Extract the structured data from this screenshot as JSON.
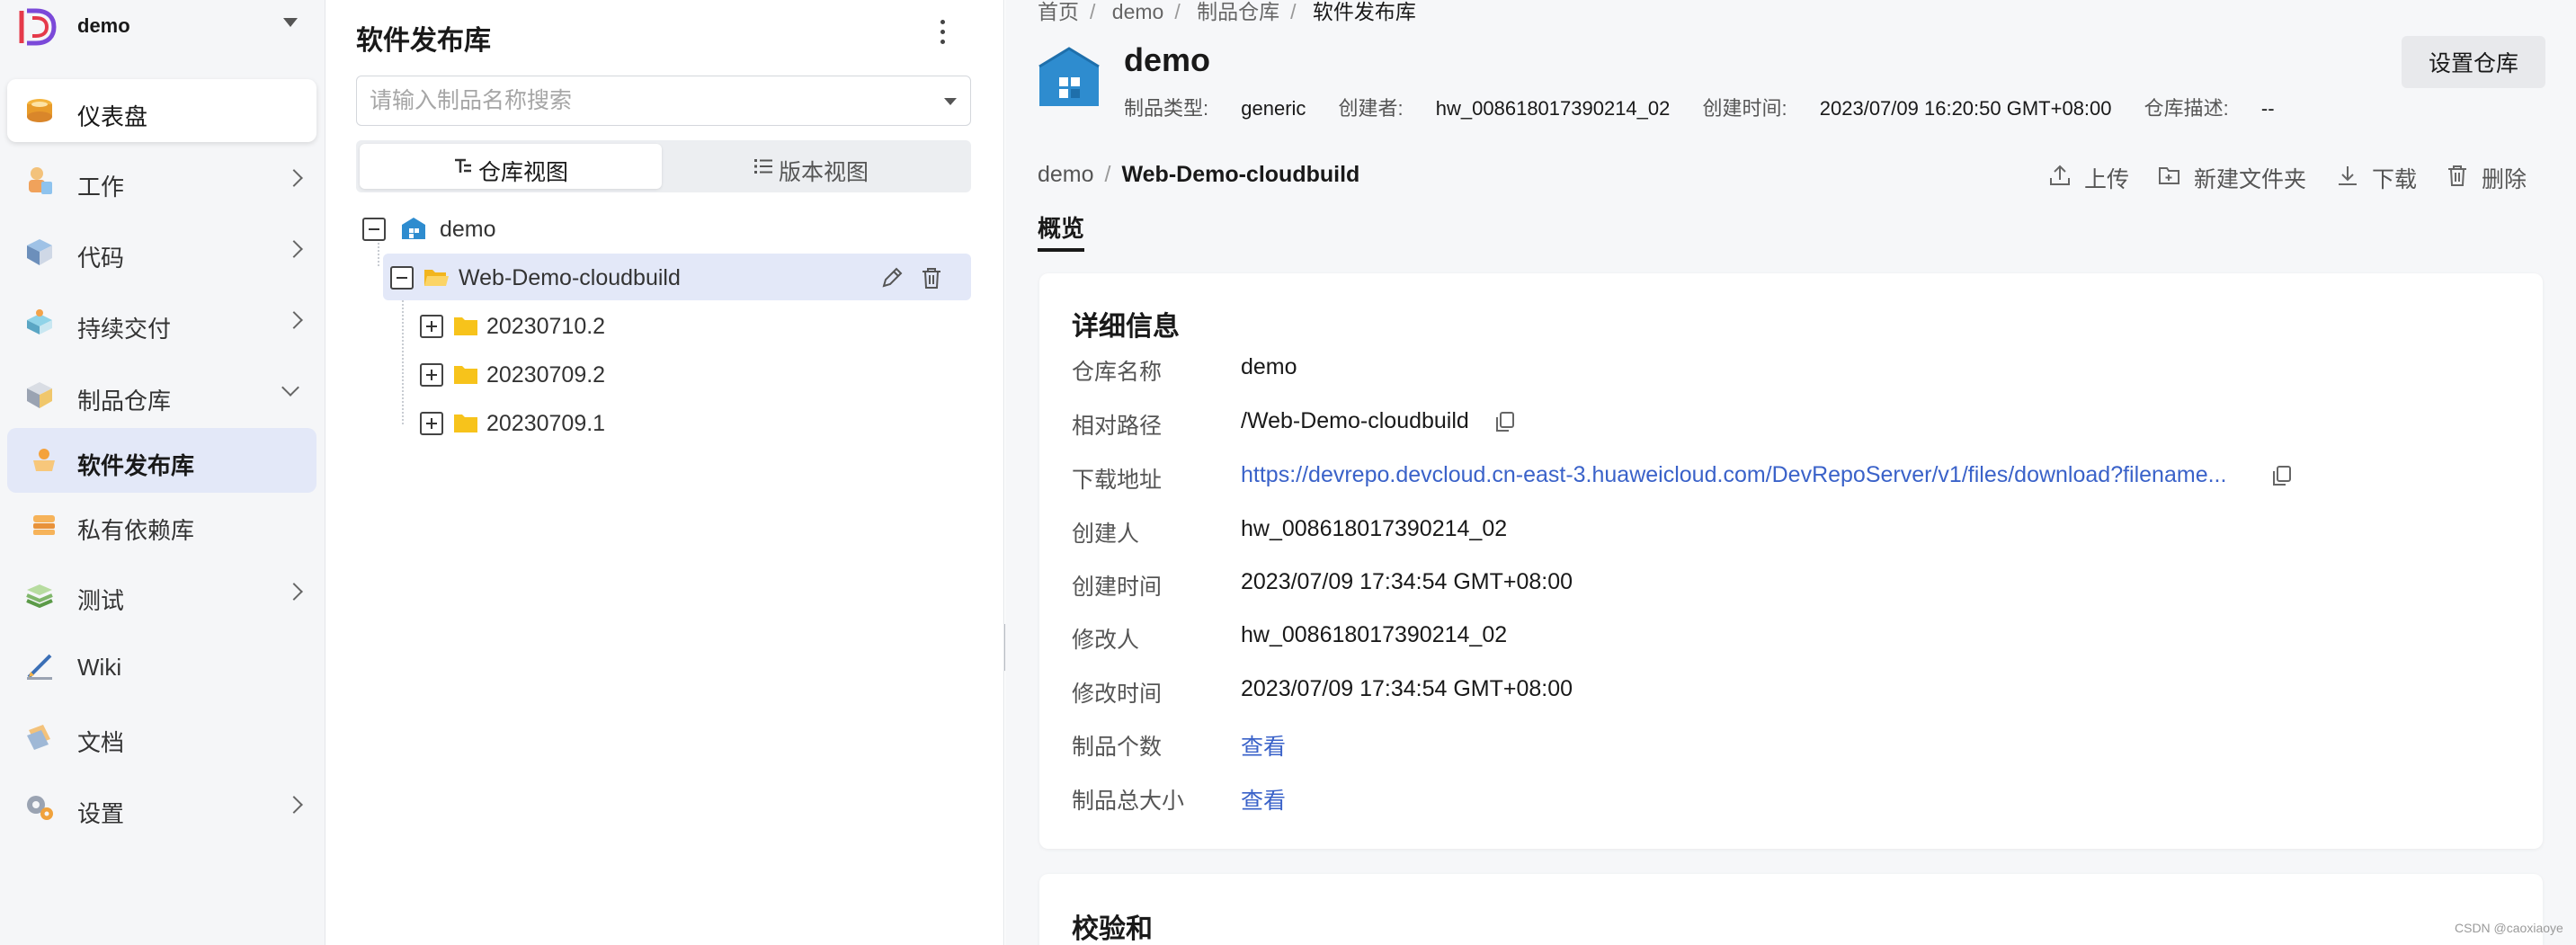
{
  "nav": {
    "project_name": "demo",
    "items": [
      {
        "label": "仪表盘"
      },
      {
        "label": "工作"
      },
      {
        "label": "代码"
      },
      {
        "label": "持续交付"
      },
      {
        "label": "制品仓库"
      },
      {
        "label": "软件发布库"
      },
      {
        "label": "私有依赖库"
      },
      {
        "label": "测试"
      },
      {
        "label": "Wiki"
      },
      {
        "label": "文档"
      },
      {
        "label": "设置"
      }
    ]
  },
  "tree_panel": {
    "title": "软件发布库",
    "search_placeholder": "请输入制品名称搜索",
    "view_tabs": [
      {
        "label": "仓库视图",
        "icon": "repo-view-icon",
        "active": true
      },
      {
        "label": "版本视图",
        "icon": "list-icon",
        "active": false
      }
    ],
    "nodes": [
      {
        "label": "demo",
        "icon": "repo-icon",
        "state": "expanded"
      },
      {
        "label": "Web-Demo-cloudbuild",
        "icon": "folder-open-icon",
        "state": "expanded",
        "selected": true
      },
      {
        "label": "20230710.2",
        "icon": "folder-icon",
        "state": "collapsed"
      },
      {
        "label": "20230709.2",
        "icon": "folder-icon",
        "state": "collapsed"
      },
      {
        "label": "20230709.1",
        "icon": "folder-icon",
        "state": "collapsed"
      }
    ]
  },
  "main": {
    "breadcrumb": [
      "首页",
      "demo",
      "制品仓库",
      "软件发布库"
    ],
    "repo": {
      "name": "demo",
      "meta": [
        {
          "key": "制品类型:",
          "value": "generic"
        },
        {
          "key": "创建者:",
          "value": "hw_008618017390214_02"
        },
        {
          "key": "创建时间:",
          "value": "2023/07/09 16:20:50 GMT+08:00"
        },
        {
          "key": "仓库描述:",
          "value": "--"
        }
      ],
      "setup_button": "设置仓库"
    },
    "path": {
      "root": "demo",
      "current": "Web-Demo-cloudbuild"
    },
    "actions": [
      {
        "label": "上传",
        "icon": "upload-icon"
      },
      {
        "label": "新建文件夹",
        "icon": "new-folder-icon"
      },
      {
        "label": "下载",
        "icon": "download-icon"
      },
      {
        "label": "删除",
        "icon": "delete-icon"
      }
    ],
    "tab": "概览",
    "details": {
      "title": "详细信息",
      "rows": [
        {
          "key": "仓库名称",
          "value": "demo"
        },
        {
          "key": "相对路径",
          "value": "/Web-Demo-cloudbuild"
        },
        {
          "key": "下载地址",
          "value": "https://devrepo.devcloud.cn-east-3.huaweicloud.com/DevRepoServer/v1/files/download?filename..."
        },
        {
          "key": "创建人",
          "value": "hw_008618017390214_02"
        },
        {
          "key": "创建时间",
          "value": "2023/07/09 17:34:54 GMT+08:00"
        },
        {
          "key": "修改人",
          "value": "hw_008618017390214_02"
        },
        {
          "key": "修改时间",
          "value": "2023/07/09 17:34:54 GMT+08:00"
        },
        {
          "key": "制品个数",
          "value": "查看"
        },
        {
          "key": "制品总大小",
          "value": "查看"
        }
      ]
    },
    "checksum": {
      "title": "校验和"
    }
  },
  "watermark": "CSDN @caoxiaoye",
  "colors": {
    "link": "#3a62c9",
    "active_bg": "#e3e8f8",
    "folder": "#f7c31b",
    "repo_icon": "#2e8ccf"
  }
}
